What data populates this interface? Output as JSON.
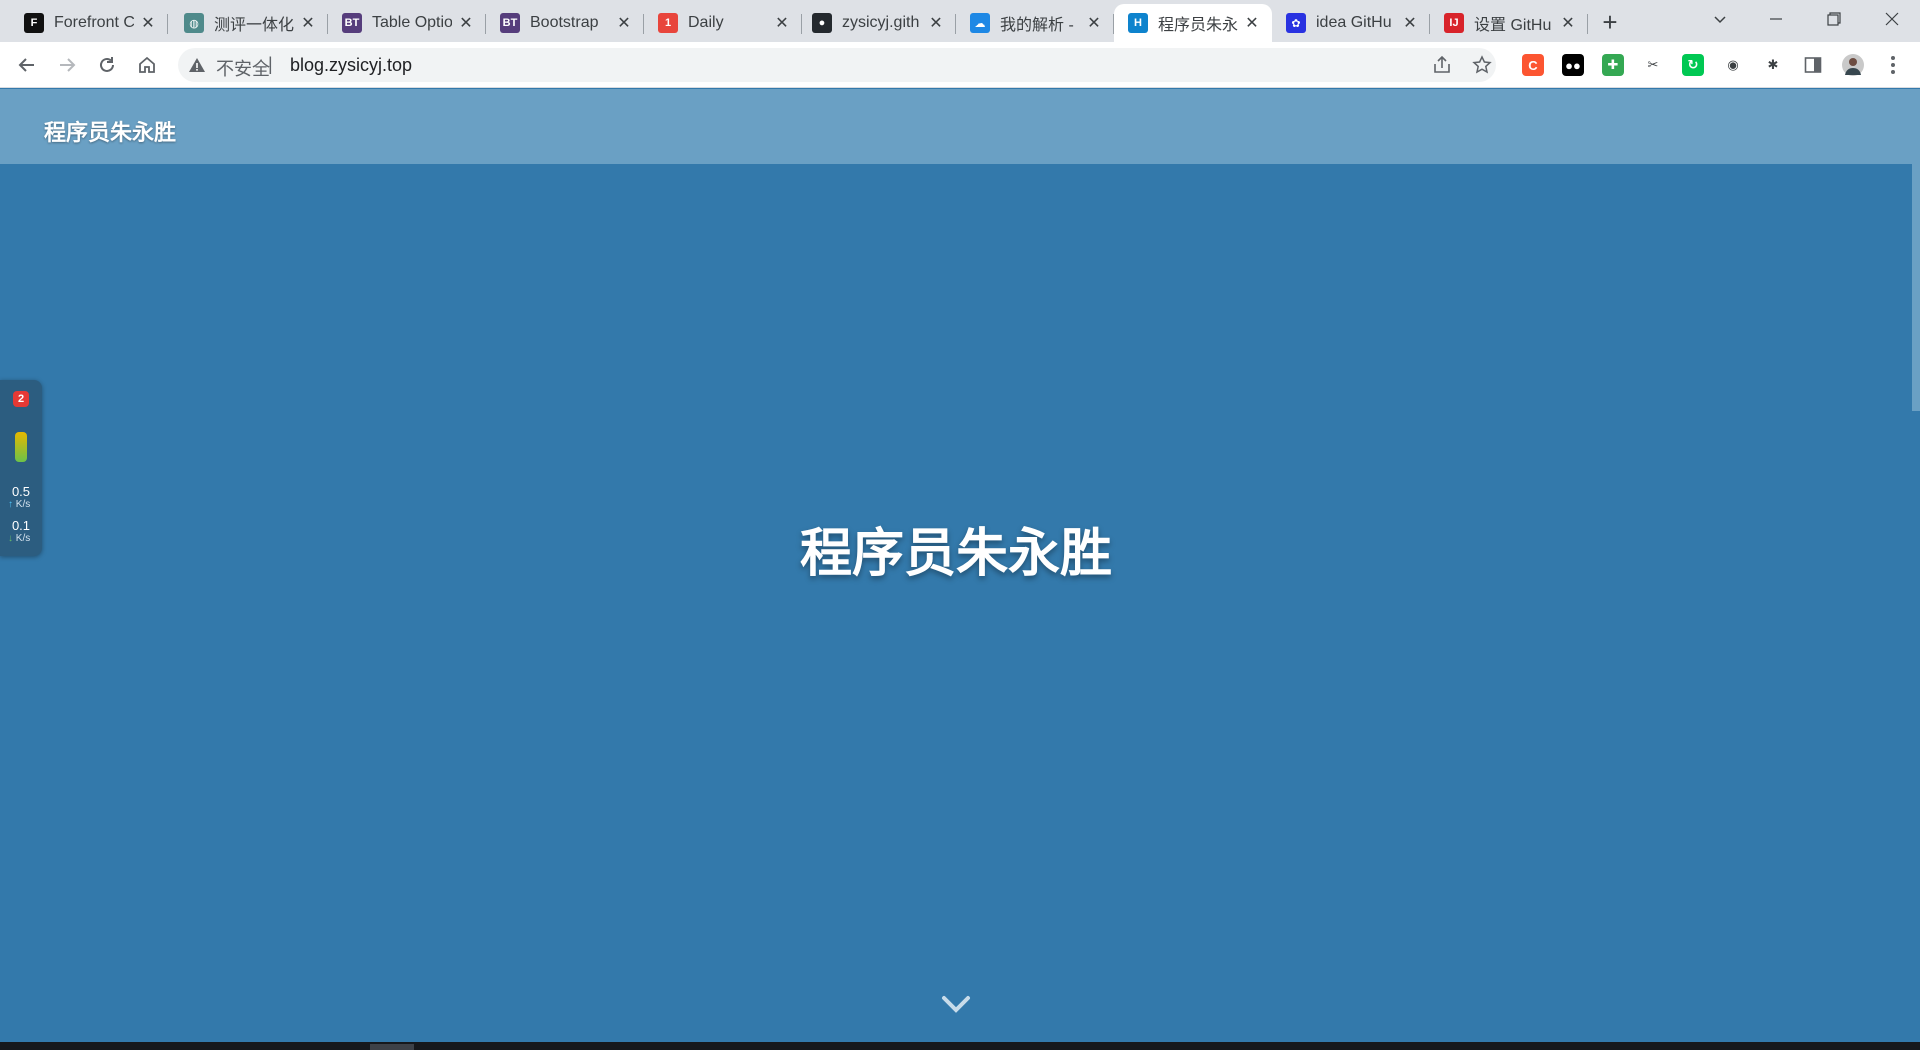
{
  "browser": {
    "tabs": [
      {
        "title": "Forefront C",
        "favicon": "forefront-icon",
        "favicon_color": "#111111",
        "favicon_glyph": "F"
      },
      {
        "title": "测评一体化",
        "favicon": "globe-icon",
        "favicon_color": "#4f8a8b",
        "favicon_glyph": "◍"
      },
      {
        "title": "Table Optio",
        "favicon": "bt-icon",
        "favicon_color": "#563d7c",
        "favicon_glyph": "BT"
      },
      {
        "title": "Bootstrap",
        "favicon": "bt-icon",
        "favicon_color": "#563d7c",
        "favicon_glyph": "BT"
      },
      {
        "title": "Daily",
        "favicon": "calendar-icon",
        "favicon_color": "#e8453c",
        "favicon_glyph": "1"
      },
      {
        "title": "zysicyj.gith",
        "favicon": "github-icon",
        "favicon_color": "#24292e",
        "favicon_glyph": "●"
      },
      {
        "title": "我的解析 -",
        "favicon": "cloud-icon",
        "favicon_color": "#1e88e5",
        "favicon_glyph": "☁"
      },
      {
        "title": "程序员朱永",
        "favicon": "hexo-icon",
        "favicon_color": "#0e83cd",
        "favicon_glyph": "H",
        "active": true
      },
      {
        "title": "idea GitHu",
        "favicon": "baidu-paw-icon",
        "favicon_color": "#2932e1",
        "favicon_glyph": "✿"
      },
      {
        "title": "设置 GitHu",
        "favicon": "intellij-icon",
        "favicon_color": "#d8232a",
        "favicon_glyph": "IJ"
      }
    ],
    "new_tab_label": "+",
    "address_bar": {
      "security_text": "不安全",
      "separator": "|",
      "url": "blog.zysicyj.top"
    },
    "extensions": [
      {
        "name": "csdn-extension-icon",
        "color": "#fc5531",
        "glyph": "C"
      },
      {
        "name": "tampermonkey-icon",
        "color": "#000000",
        "glyph": "●●"
      },
      {
        "name": "green-puzzle-extension-icon",
        "color": "#34a853",
        "glyph": "✚"
      },
      {
        "name": "scissors-extension-icon",
        "color": "#ffffff",
        "glyph": "✂"
      },
      {
        "name": "green-sync-extension-icon",
        "color": "#00c853",
        "glyph": "↻"
      },
      {
        "name": "gray-circles-extension-icon",
        "color": "#ffffff",
        "glyph": "◉"
      },
      {
        "name": "extensions-puzzle-icon",
        "color": "#ffffff",
        "glyph": "✱"
      }
    ]
  },
  "page": {
    "header_title": "程序员朱永胜",
    "hero_title": "程序员朱永胜"
  },
  "net_widget": {
    "badge": "2",
    "upload_value": "0.5",
    "upload_unit": "K/s",
    "download_value": "0.1",
    "download_unit": "K/s"
  },
  "colors": {
    "hero_bg": "#3379ab",
    "header_bg": "#6aa0c4",
    "tabstrip_bg": "#dee1e6"
  }
}
